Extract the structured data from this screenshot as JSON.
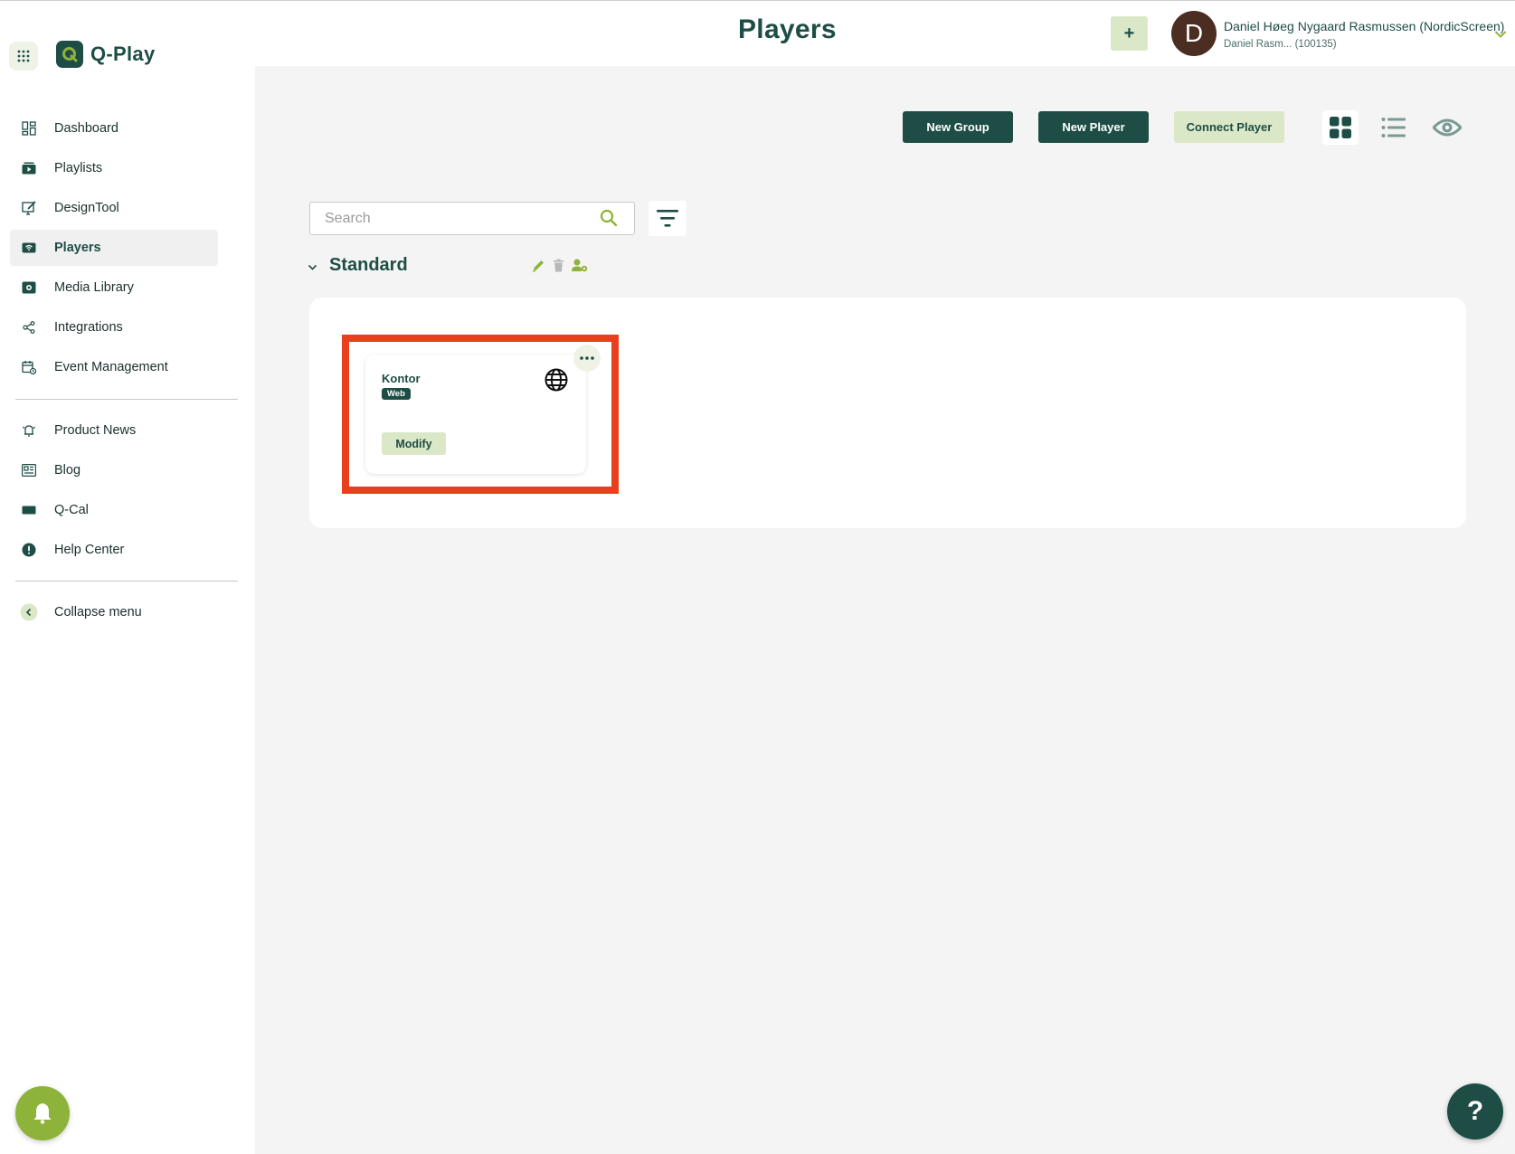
{
  "app": {
    "logo_text": "Q-Play"
  },
  "sidebar": {
    "items": [
      {
        "label": "Dashboard",
        "icon": "dashboard-icon"
      },
      {
        "label": "Playlists",
        "icon": "playlists-icon"
      },
      {
        "label": "DesignTool",
        "icon": "designtool-icon"
      },
      {
        "label": "Players",
        "icon": "players-icon",
        "active": true
      },
      {
        "label": "Media Library",
        "icon": "media-library-icon"
      },
      {
        "label": "Integrations",
        "icon": "integrations-icon"
      },
      {
        "label": "Event Management",
        "icon": "event-management-icon"
      }
    ],
    "secondary": [
      {
        "label": "Product News",
        "icon": "product-news-icon"
      },
      {
        "label": "Blog",
        "icon": "blog-icon"
      },
      {
        "label": "Q-Cal",
        "icon": "qcal-icon"
      },
      {
        "label": "Help Center",
        "icon": "help-center-icon"
      }
    ],
    "collapse_label": "Collapse menu"
  },
  "header": {
    "title": "Players",
    "plus_label": "+",
    "user": {
      "initial": "D",
      "name": "Daniel Høeg Nygaard Rasmussen (NordicScreen)",
      "sub": "Daniel Rasm... (100135)"
    }
  },
  "toolbar": {
    "new_group": "New Group",
    "new_player": "New Player",
    "connect_player": "Connect Player"
  },
  "search": {
    "placeholder": "Search",
    "value": ""
  },
  "group": {
    "title": "Standard",
    "players": [
      {
        "name": "Kontor",
        "type": "Web",
        "modify_label": "Modify"
      }
    ]
  },
  "help": {
    "label": "?"
  },
  "colors": {
    "brand_dark": "#1e4d46",
    "brand_light": "#dbe8c7",
    "accent_green": "#8db33a",
    "highlight_red": "#e8401c"
  }
}
